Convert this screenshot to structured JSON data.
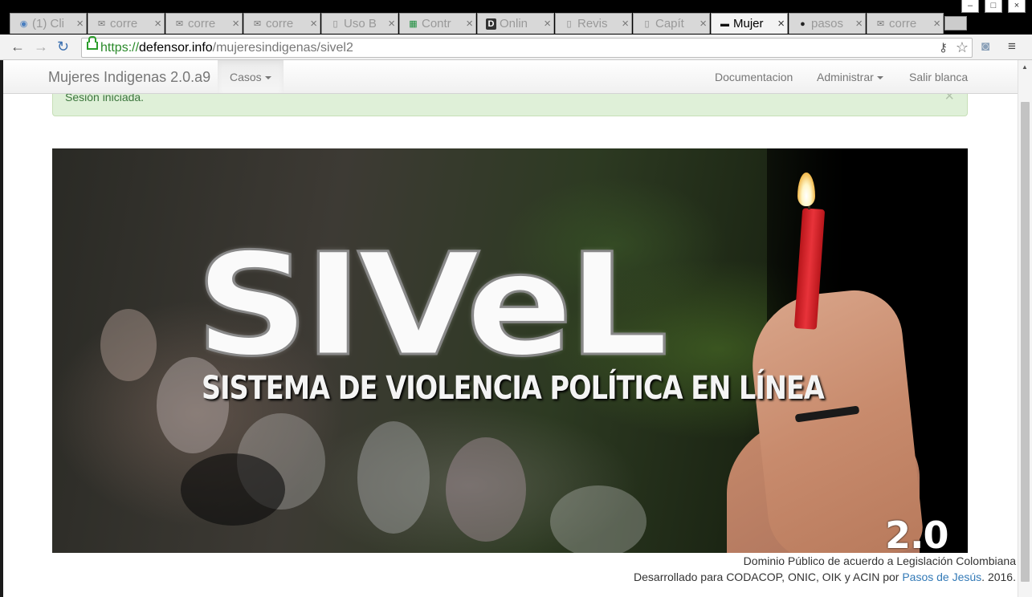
{
  "browser": {
    "tabs": [
      {
        "title": "(1) Cli",
        "icon": "chat-bubble-icon",
        "active": false
      },
      {
        "title": "corre",
        "icon": "mail-icon",
        "active": false
      },
      {
        "title": "corre",
        "icon": "mail-icon",
        "active": false
      },
      {
        "title": "corre",
        "icon": "mail-icon",
        "active": false
      },
      {
        "title": "Uso B",
        "icon": "document-icon",
        "active": false
      },
      {
        "title": "Contr",
        "icon": "spreadsheet-icon",
        "active": false
      },
      {
        "title": "Onlin",
        "icon": "d-logo-icon",
        "active": false
      },
      {
        "title": "Revis",
        "icon": "document-icon",
        "active": false
      },
      {
        "title": "Capít",
        "icon": "document-icon",
        "active": false
      },
      {
        "title": "Mujer",
        "icon": "sivel-favicon-icon",
        "active": true
      },
      {
        "title": "pasos",
        "icon": "github-icon",
        "active": false
      },
      {
        "title": "corre",
        "icon": "mail-icon",
        "active": false
      }
    ],
    "close_glyph": "×",
    "url": {
      "scheme": "https://",
      "host": "defensor.info",
      "path": "/mujeresindigenas/sivel2"
    }
  },
  "navbar": {
    "brand": "Mujeres Indigenas 2.0.a9",
    "casos": "Casos",
    "documentacion": "Documentacion",
    "administrar": "Administrar",
    "salir": "Salir blanca"
  },
  "alert": {
    "message": "Sesión iniciada.",
    "close": "×"
  },
  "banner": {
    "logo": "SIVeL",
    "subtitle": "SISTEMA DE VIOLENCIA POLÍTICA EN LÍNEA",
    "version": "2.0"
  },
  "footer": {
    "line1": "Dominio Público de acuerdo a Legislación Colombiana",
    "line2_prefix": "Desarrollado para CODACOP, ONIC, OIK y ACIN por ",
    "line2_link": "Pasos de Jesús",
    "line2_suffix": ". 2016."
  }
}
